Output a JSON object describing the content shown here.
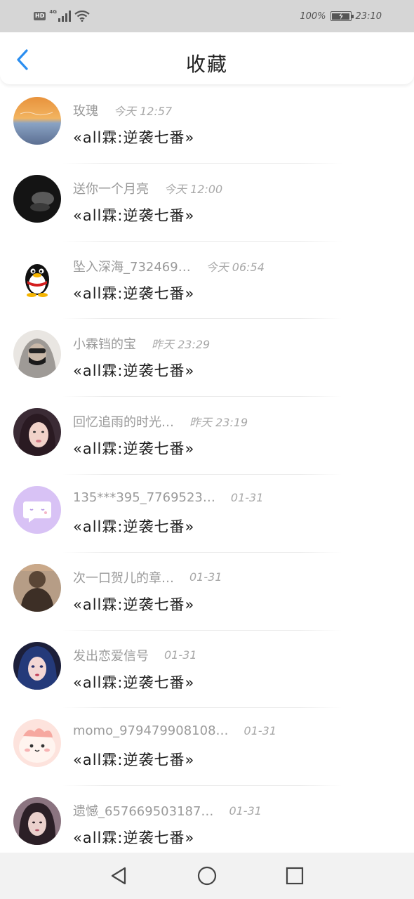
{
  "status_bar": {
    "hd": "HD",
    "network": "4G",
    "battery_percent": "100%",
    "time": "23:10",
    "battery_level": 1.0
  },
  "header": {
    "title": "收藏",
    "back_icon": "chevron-left-icon",
    "accent_color": "#2b8ef0"
  },
  "items": [
    {
      "name": "玫瑰",
      "time": "今天 12:57",
      "message": "«all霖:逆袭七番»",
      "avatar": "sunset-avatar"
    },
    {
      "name": "送你一个月亮",
      "time": "今天 12:00",
      "message": "«all霖:逆袭七番»",
      "avatar": "dark-hand-avatar"
    },
    {
      "name": "坠入深海_732469…",
      "time": "今天 06:54",
      "message": "«all霖:逆袭七番»",
      "avatar": "penguin-avatar"
    },
    {
      "name": "小霖铛的宝",
      "time": "昨天 23:29",
      "message": "«all霖:逆袭七番»",
      "avatar": "masked-person-avatar"
    },
    {
      "name": "回忆追雨的时光…",
      "time": "昨天 23:19",
      "message": "«all霖:逆袭七番»",
      "avatar": "girl-portrait-avatar"
    },
    {
      "name": "135***395_7769523…",
      "time": "01-31",
      "message": "«all霖:逆袭七番»",
      "avatar": "chat-bubble-avatar"
    },
    {
      "name": "次一口贺儿的章…",
      "time": "01-31",
      "message": "«all霖:逆袭七番»",
      "avatar": "brown-figure-avatar"
    },
    {
      "name": "发出恋爱信号",
      "time": "01-31",
      "message": "«all霖:逆袭七番»",
      "avatar": "blue-hair-girl-avatar"
    },
    {
      "name": "momo_979479908108…",
      "time": "01-31",
      "message": "«all霖:逆袭七番»",
      "avatar": "pink-cartoon-avatar"
    },
    {
      "name": "遗憾_657669503187…",
      "time": "01-31",
      "message": "«all霖:逆袭七番»",
      "avatar": "dark-hair-girl-avatar"
    }
  ],
  "nav": {
    "back_icon": "triangle-back-icon",
    "home_icon": "circle-home-icon",
    "recent_icon": "square-recent-icon"
  }
}
